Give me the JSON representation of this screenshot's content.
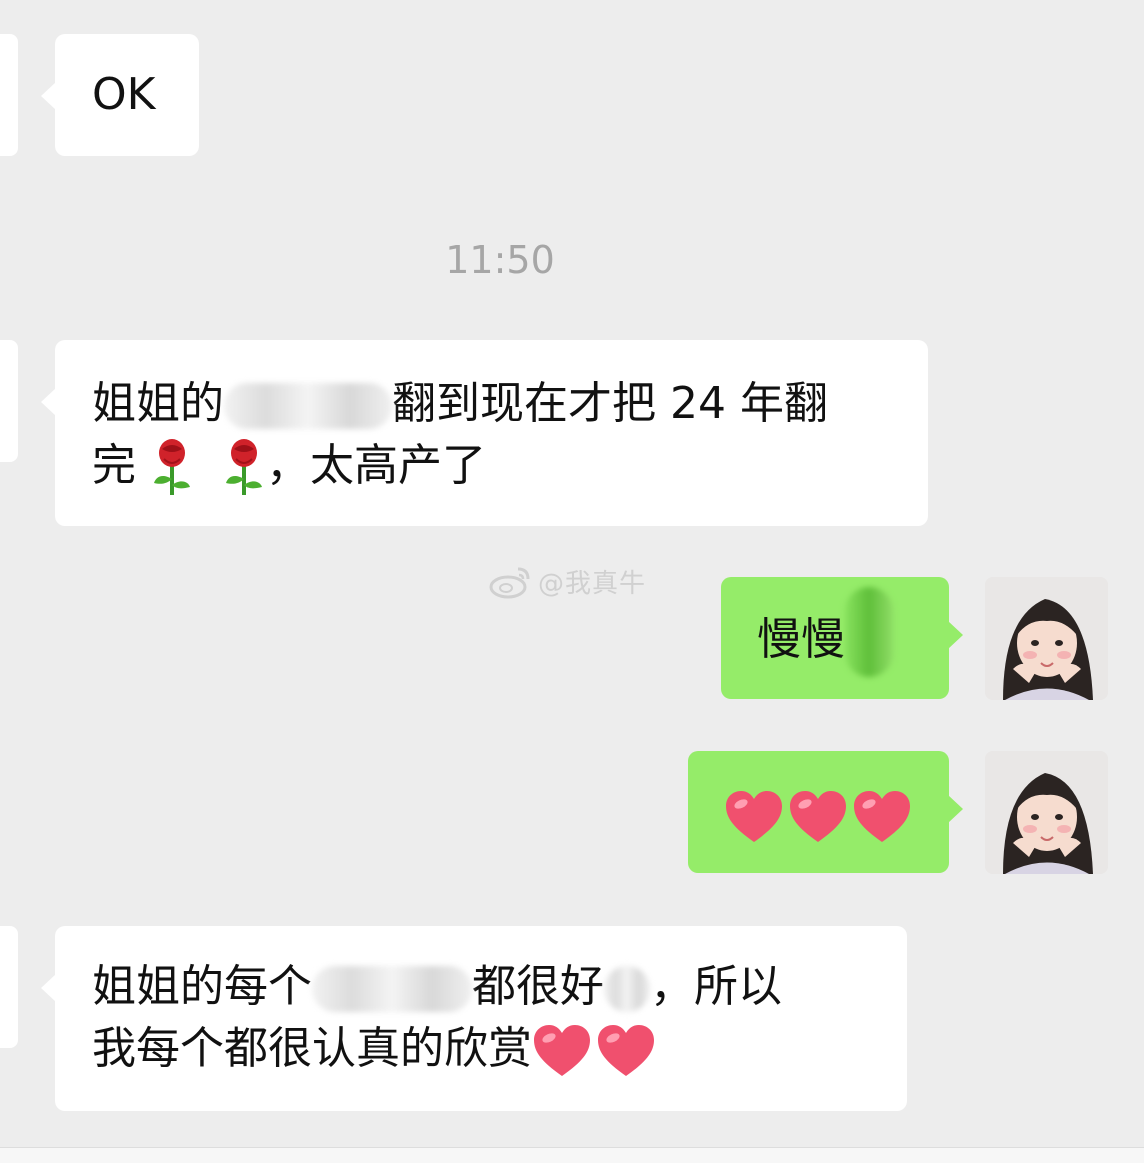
{
  "messages": [
    {
      "side": "in",
      "text": "OK"
    },
    {
      "timestamp": "11:50"
    },
    {
      "side": "in",
      "line1_a": "姐姐的",
      "line1_b": "翻到现在才把 24 年翻",
      "line2_a": "完",
      "line2_b": "，太高产了",
      "emoji": "rose"
    },
    {
      "side": "out",
      "text": "慢慢",
      "emoji": "avatar"
    },
    {
      "side": "out",
      "emoji": "heart",
      "count": 3
    },
    {
      "side": "in",
      "line1_a": "姐姐的每个",
      "line1_b": "都很好",
      "line1_c": "，所以",
      "line2": "我每个都很认真的欣赏",
      "emoji": "heart",
      "count": 2
    }
  ],
  "watermark": {
    "text": "@我真牛",
    "icon": "weibo-icon"
  },
  "colors": {
    "background": "#ededed",
    "incoming": "#ffffff",
    "outgoing": "#95ec69",
    "timestamp": "#a6a6a6"
  }
}
